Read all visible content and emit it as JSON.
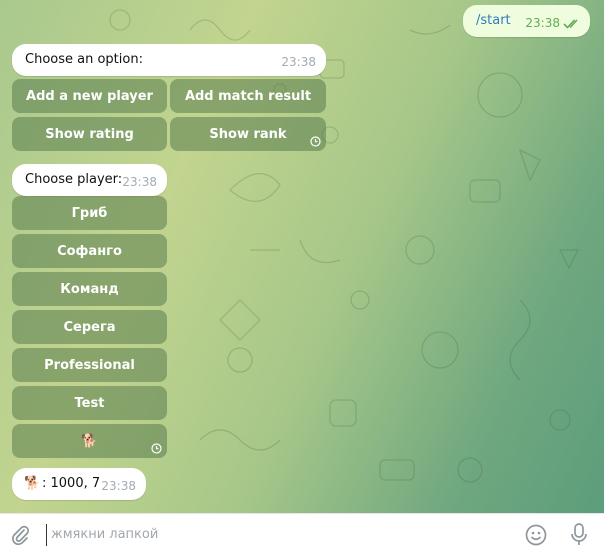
{
  "outgoing": {
    "text": "/start",
    "time": "23:38",
    "status_icon": "double-check-icon"
  },
  "menu_message": {
    "text": "Choose an option:",
    "time": "23:38",
    "buttons": [
      "Add a new player",
      "Add match result",
      "Show rating",
      "Show rank"
    ]
  },
  "player_message": {
    "text": "Choose player:",
    "time": "23:38",
    "buttons": [
      "Гриб",
      "Софанго",
      "Команд",
      "Серега",
      "Professional",
      "Test",
      "🐕"
    ]
  },
  "result_message": {
    "emoji": "🐕",
    "text": ": 1000, 7",
    "time": "23:38"
  },
  "composer": {
    "placeholder": "жмякни лапкой"
  },
  "colors": {
    "button_bg": "#54784a",
    "outgoing_bg": "#effdde",
    "check": "#62ac55"
  }
}
